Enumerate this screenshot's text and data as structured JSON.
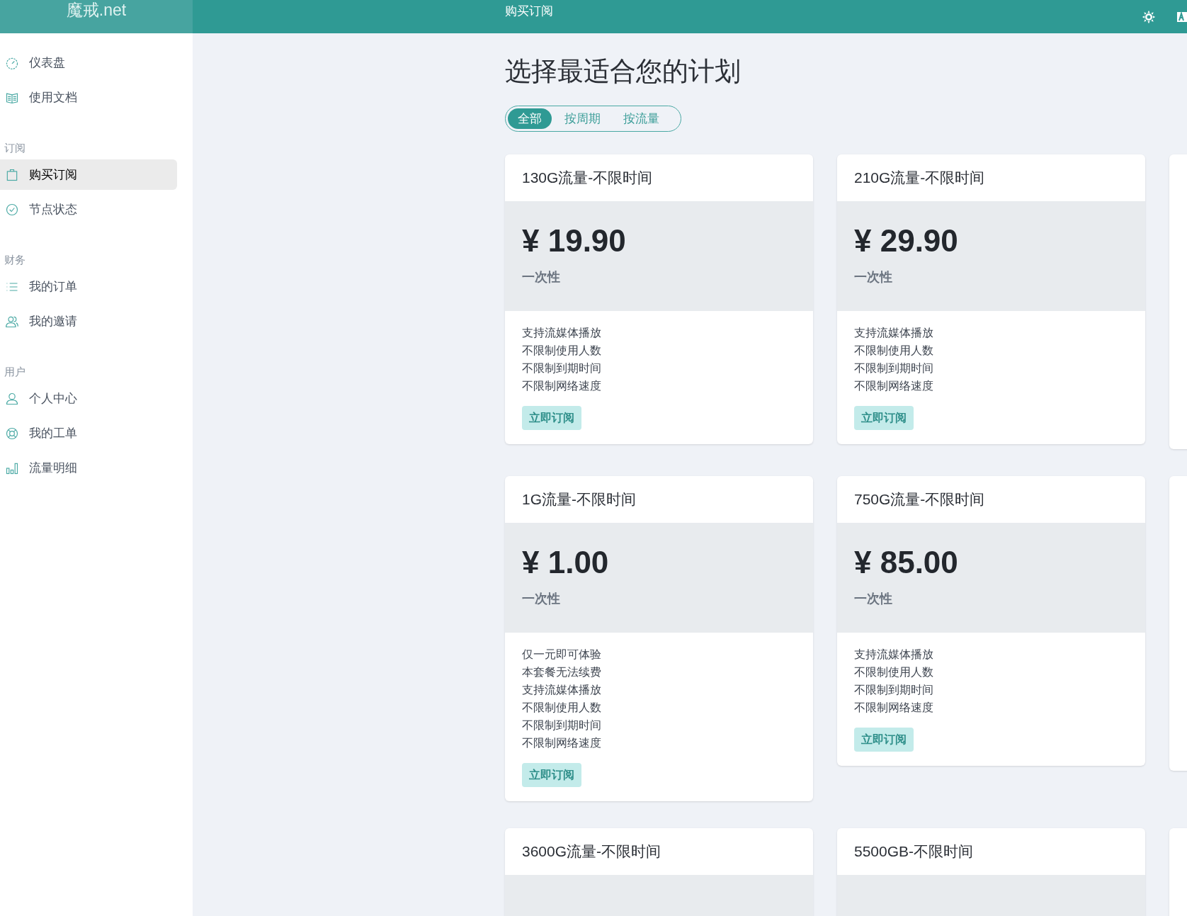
{
  "header": {
    "logo": "魔戒.net",
    "title": "购买订阅"
  },
  "sidebar": {
    "groups": [
      {
        "items": [
          {
            "label": "仪表盘",
            "kind": "gauge",
            "selected": false
          },
          {
            "label": "使用文档",
            "kind": "book",
            "selected": false
          }
        ]
      },
      {
        "heading": "订阅",
        "items": [
          {
            "label": "购买订阅",
            "kind": "bag",
            "selected": true
          },
          {
            "label": "节点状态",
            "kind": "check",
            "selected": false
          }
        ]
      },
      {
        "heading": "财务",
        "items": [
          {
            "label": "我的订单",
            "kind": "list",
            "selected": false
          },
          {
            "label": "我的邀请",
            "kind": "users",
            "selected": false
          }
        ]
      },
      {
        "heading": "用户",
        "items": [
          {
            "label": "个人中心",
            "kind": "user",
            "selected": false
          },
          {
            "label": "我的工单",
            "kind": "lifebuoy",
            "selected": false
          },
          {
            "label": "流量明细",
            "kind": "chart",
            "selected": false
          }
        ]
      }
    ]
  },
  "page": {
    "heading": "选择最适合您的计划",
    "tabs": [
      {
        "label": "全部",
        "selected": true
      },
      {
        "label": "按周期",
        "selected": false
      },
      {
        "label": "按流量",
        "selected": false
      }
    ],
    "plans": [
      {
        "name": "130G流量-不限时间",
        "price": "¥ 19.90",
        "period": "一次性",
        "features": [
          "支持流媒体播放",
          "不限制使用人数",
          "不限制到期时间",
          "不限制网络速度"
        ],
        "button": "立即订阅"
      },
      {
        "name": "210G流量-不限时间",
        "price": "¥ 29.90",
        "period": "一次性",
        "features": [
          "支持流媒体播放",
          "不限制使用人数",
          "不限制到期时间",
          "不限制网络速度"
        ],
        "button": "立即订阅"
      },
      {
        "name": "1G流量-不限时间",
        "price": "¥ 1.00",
        "period": "一次性",
        "features": [
          "仅一元即可体验",
          "本套餐无法续费",
          "支持流媒体播放",
          "不限制使用人数",
          "不限制到期时间",
          "不限制网络速度"
        ],
        "button": "立即订阅"
      },
      {
        "name": "750G流量-不限时间",
        "price": "¥ 85.00",
        "period": "一次性",
        "features": [
          "支持流媒体播放",
          "不限制使用人数",
          "不限制到期时间",
          "不限制网络速度"
        ],
        "button": "立即订阅"
      },
      {
        "name": "3600G流量-不限时间"
      },
      {
        "name": "5500GB-不限时间"
      }
    ]
  }
}
